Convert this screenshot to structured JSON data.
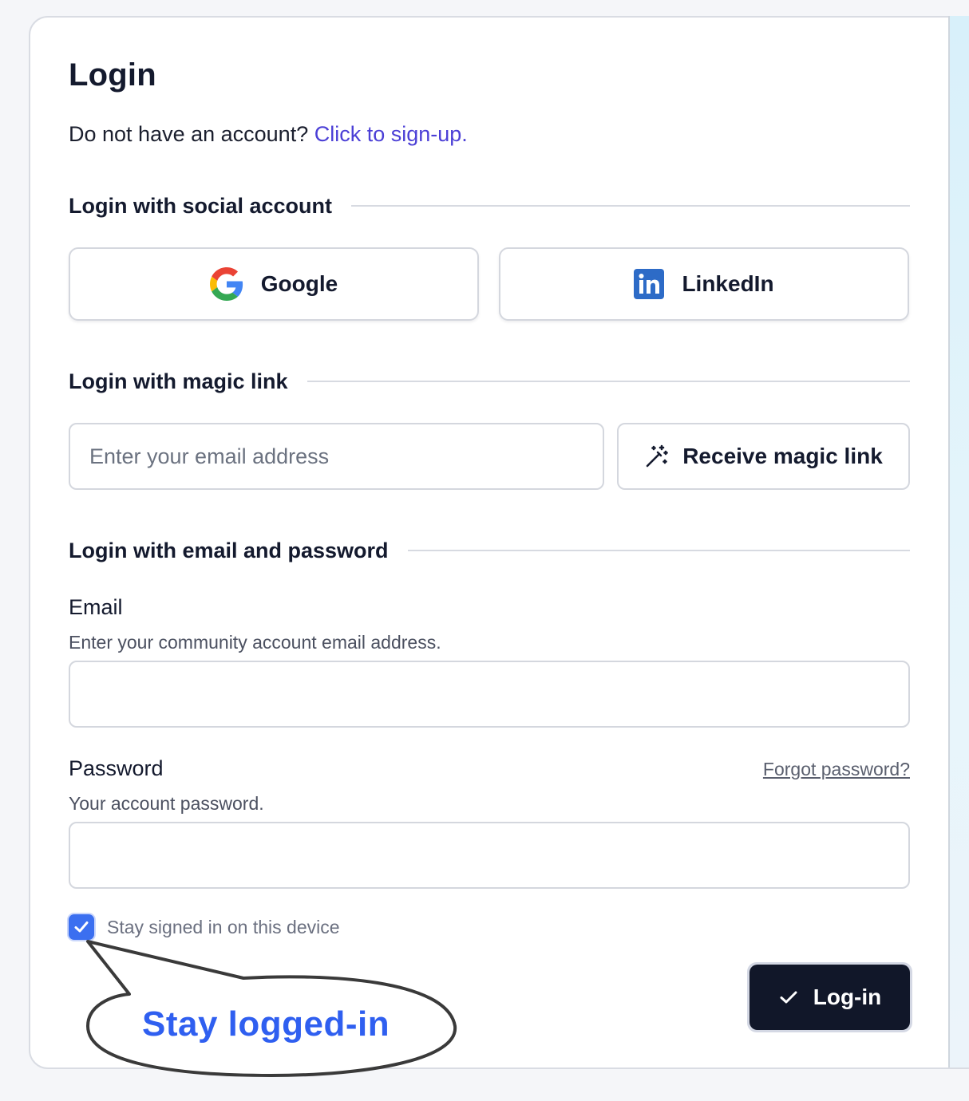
{
  "colors": {
    "accent_link": "#4b3fd6",
    "checkbox": "#3b6ff0",
    "primary_button": "#111729",
    "callout_text": "#2f5ff0",
    "linkedin": "#2d6bc7"
  },
  "header": {
    "title": "Login",
    "signup_prompt": "Do not have an account? ",
    "signup_link": "Click to sign-up."
  },
  "social": {
    "heading": "Login with social account",
    "google_label": "Google",
    "google_icon": "google-g-icon",
    "linkedin_label": "LinkedIn",
    "linkedin_icon": "linkedin-icon"
  },
  "magic": {
    "heading": "Login with magic link",
    "email_placeholder": "Enter your email address",
    "email_value": "",
    "button_label": "Receive magic link",
    "button_icon": "magic-wand-icon"
  },
  "credentials": {
    "heading": "Login with email and password",
    "email_label": "Email",
    "email_help": "Enter your community account email address.",
    "email_value": "",
    "password_label": "Password",
    "password_help": "Your account password.",
    "password_value": "",
    "forgot_label": "Forgot password?"
  },
  "remember": {
    "label": "Stay signed in on this device",
    "checked": true
  },
  "submit": {
    "label": "Log-in",
    "icon": "checkmark-icon"
  },
  "callout": {
    "text": "Stay logged-in"
  }
}
